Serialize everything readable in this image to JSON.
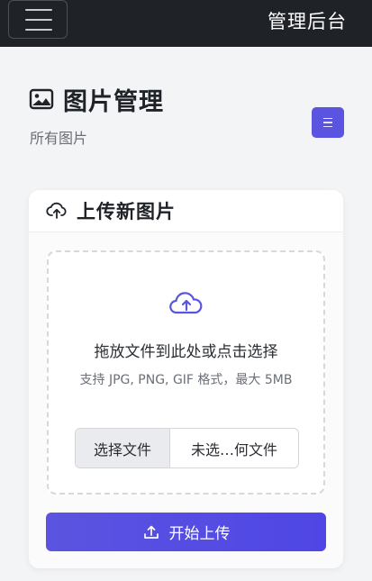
{
  "navbar": {
    "brand": "管理后台",
    "menu_icon": "hamburger-icon"
  },
  "page": {
    "title": "图片管理",
    "title_icon": "image-icon",
    "subtitle": "所有图片",
    "view_toggle_icon": "list-icon"
  },
  "upload_card": {
    "title": "上传新图片",
    "title_icon": "cloud-upload-icon",
    "dropzone": {
      "icon": "cloud-upload-icon",
      "title": "拖放文件到此处或点击选择",
      "hint": "支持 JPG, PNG, GIF 格式，最大 5MB"
    },
    "file_input": {
      "button_label": "选择文件",
      "status": "未选…何文件"
    },
    "submit": {
      "label": "开始上传",
      "icon": "upload-icon"
    }
  },
  "colors": {
    "navbar_bg": "#1f2328",
    "accent": "#5b54e0",
    "page_bg": "#f3f4f6"
  }
}
